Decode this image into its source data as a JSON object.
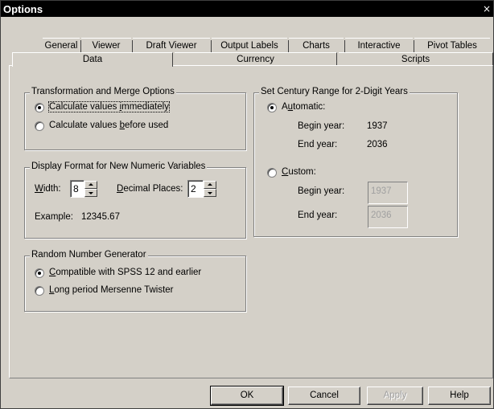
{
  "window": {
    "title": "Options",
    "close_glyph": "×"
  },
  "tabs": {
    "back_row": [
      "General",
      "Viewer",
      "Draft Viewer",
      "Output Labels",
      "Charts",
      "Interactive",
      "Pivot Tables"
    ],
    "front_row": [
      "Data",
      "Currency",
      "Scripts"
    ],
    "selected": "Data"
  },
  "transformation": {
    "legend": "Transformation and Merge Options",
    "options": [
      {
        "label": "Calculate values immediately",
        "selected": true
      },
      {
        "label": "Calculate values before used",
        "selected": false
      }
    ]
  },
  "display_format": {
    "legend": "Display Format for New Numeric Variables",
    "width_label": "Width:",
    "width_value": "8",
    "decimal_label": "Decimal Places:",
    "decimal_value": "2",
    "example_label": "Example:",
    "example_value": "12345.67"
  },
  "random": {
    "legend": "Random Number Generator",
    "options": [
      {
        "label": "Compatible with SPSS 12 and earlier",
        "selected": true
      },
      {
        "label": "Long period Mersenne Twister",
        "selected": false
      }
    ]
  },
  "century": {
    "legend": "Set Century Range for 2-Digit Years",
    "automatic_label": "Automatic:",
    "automatic_selected": true,
    "begin_label": "Begin year:",
    "begin_value": "1937",
    "end_label": "End year:",
    "end_value": "2036",
    "custom_label": "Custom:",
    "custom_selected": false,
    "custom_begin_label": "Begin year:",
    "custom_begin_value": "1937",
    "custom_end_label": "End year:",
    "custom_end_value": "2036"
  },
  "buttons": {
    "ok": "OK",
    "cancel": "Cancel",
    "apply": "Apply",
    "help": "Help"
  }
}
